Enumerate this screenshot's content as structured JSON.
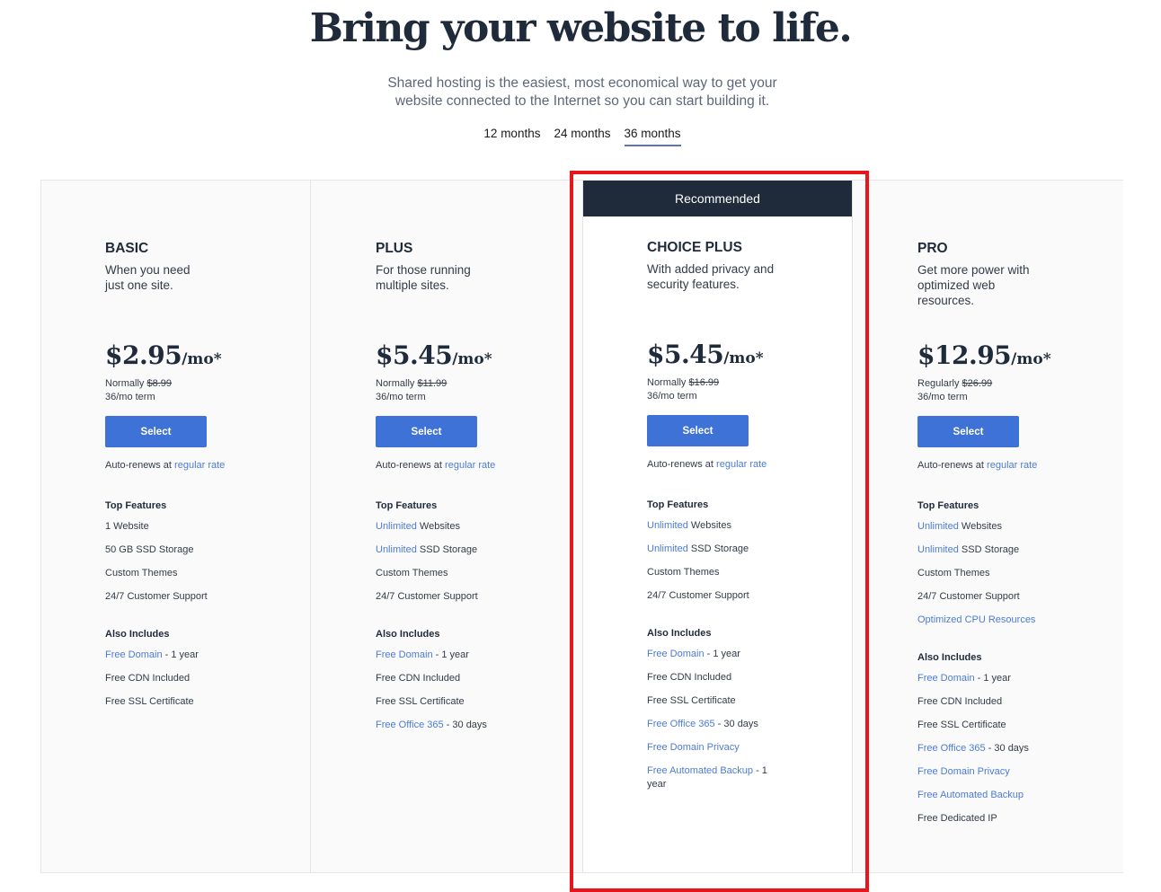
{
  "header": {
    "title": "Bring your website to life.",
    "subtitle_line1": "Shared hosting is the easiest, most economical way to get your",
    "subtitle_line2": "website connected to the Internet so you can start building it."
  },
  "term_tabs": [
    {
      "label": "12 months",
      "active": false
    },
    {
      "label": "24 months",
      "active": false
    },
    {
      "label": "36 months",
      "active": true
    }
  ],
  "colors": {
    "accent_blue": "#3f72d7",
    "link_blue": "#4d7bd3",
    "navy": "#1f2a3a",
    "highlight_red": "#e8161b",
    "tab_underline": "#5b75bd"
  },
  "plans": [
    {
      "name": "BASIC",
      "desc_line1": "When you need",
      "desc_line2": "just one site.",
      "price": "$2.95",
      "unit": "/mo*",
      "normal_label": "Normally",
      "normal_price": "$8.99",
      "term": "36/mo term",
      "button": "Select",
      "renew_prefix": "Auto-renews at",
      "renew_link": "regular rate",
      "top_features_title": "Top Features",
      "top_features": [
        {
          "link": "",
          "text": "1 Website"
        },
        {
          "link": "",
          "text": "50 GB SSD Storage"
        },
        {
          "link": "",
          "text": "Custom Themes"
        },
        {
          "link": "",
          "text": "24/7 Customer Support"
        }
      ],
      "also_title": "Also Includes",
      "also": [
        {
          "link": "Free Domain",
          "text": " - 1 year"
        },
        {
          "link": "",
          "text": "Free CDN Included"
        },
        {
          "link": "",
          "text": "Free SSL Certificate"
        }
      ]
    },
    {
      "name": "PLUS",
      "desc_line1": "For those running",
      "desc_line2": "multiple sites.",
      "price": "$5.45",
      "unit": "/mo*",
      "normal_label": "Normally",
      "normal_price": "$11.99",
      "term": "36/mo term",
      "button": "Select",
      "renew_prefix": "Auto-renews at",
      "renew_link": "regular rate",
      "top_features_title": "Top Features",
      "top_features": [
        {
          "link": "Unlimited",
          "text": " Websites"
        },
        {
          "link": "Unlimited",
          "text": " SSD Storage"
        },
        {
          "link": "",
          "text": "Custom Themes"
        },
        {
          "link": "",
          "text": "24/7 Customer Support"
        }
      ],
      "also_title": "Also Includes",
      "also": [
        {
          "link": "Free Domain",
          "text": " - 1 year"
        },
        {
          "link": "",
          "text": "Free CDN Included"
        },
        {
          "link": "",
          "text": "Free SSL Certificate"
        },
        {
          "link": "Free Office 365",
          "text": " - 30 days"
        }
      ]
    },
    {
      "name": "CHOICE PLUS",
      "banner": "Recommended",
      "desc_line1": "With added privacy and",
      "desc_line2": "security features.",
      "price": "$5.45",
      "unit": "/mo*",
      "normal_label": "Normally",
      "normal_price": "$16.99",
      "term": "36/mo term",
      "button": "Select",
      "renew_prefix": "Auto-renews at",
      "renew_link": "regular rate",
      "top_features_title": "Top Features",
      "top_features": [
        {
          "link": "Unlimited",
          "text": " Websites"
        },
        {
          "link": "Unlimited",
          "text": " SSD Storage"
        },
        {
          "link": "",
          "text": "Custom Themes"
        },
        {
          "link": "",
          "text": "24/7 Customer Support"
        }
      ],
      "also_title": "Also Includes",
      "also": [
        {
          "link": "Free Domain",
          "text": " - 1 year"
        },
        {
          "link": "",
          "text": "Free CDN Included"
        },
        {
          "link": "",
          "text": "Free SSL Certificate"
        },
        {
          "link": "Free Office 365",
          "text": " - 30 days"
        },
        {
          "link": "Free Domain Privacy",
          "text": ""
        },
        {
          "link": "Free Automated Backup",
          "text": " - 1 year"
        }
      ]
    },
    {
      "name": "PRO",
      "desc_line1": "Get more power with",
      "desc_line2": "optimized web",
      "desc_line3": "resources.",
      "price": "$12.95",
      "unit": "/mo*",
      "normal_label": "Regularly",
      "normal_price": "$26.99",
      "term": "36/mo term",
      "button": "Select",
      "renew_prefix": "Auto-renews at",
      "renew_link": "regular rate",
      "top_features_title": "Top Features",
      "top_features": [
        {
          "link": "Unlimited",
          "text": " Websites"
        },
        {
          "link": "Unlimited",
          "text": " SSD Storage"
        },
        {
          "link": "",
          "text": "Custom Themes"
        },
        {
          "link": "",
          "text": "24/7 Customer Support"
        },
        {
          "link": "Optimized CPU Resources",
          "text": ""
        }
      ],
      "also_title": "Also Includes",
      "also": [
        {
          "link": "Free Domain",
          "text": " - 1 year"
        },
        {
          "link": "",
          "text": "Free CDN Included"
        },
        {
          "link": "",
          "text": "Free SSL Certificate"
        },
        {
          "link": "Free Office 365",
          "text": " - 30 days"
        },
        {
          "link": "Free Domain Privacy",
          "text": ""
        },
        {
          "link": "Free Automated Backup",
          "text": ""
        },
        {
          "link": "",
          "text": "Free Dedicated IP"
        }
      ]
    }
  ]
}
